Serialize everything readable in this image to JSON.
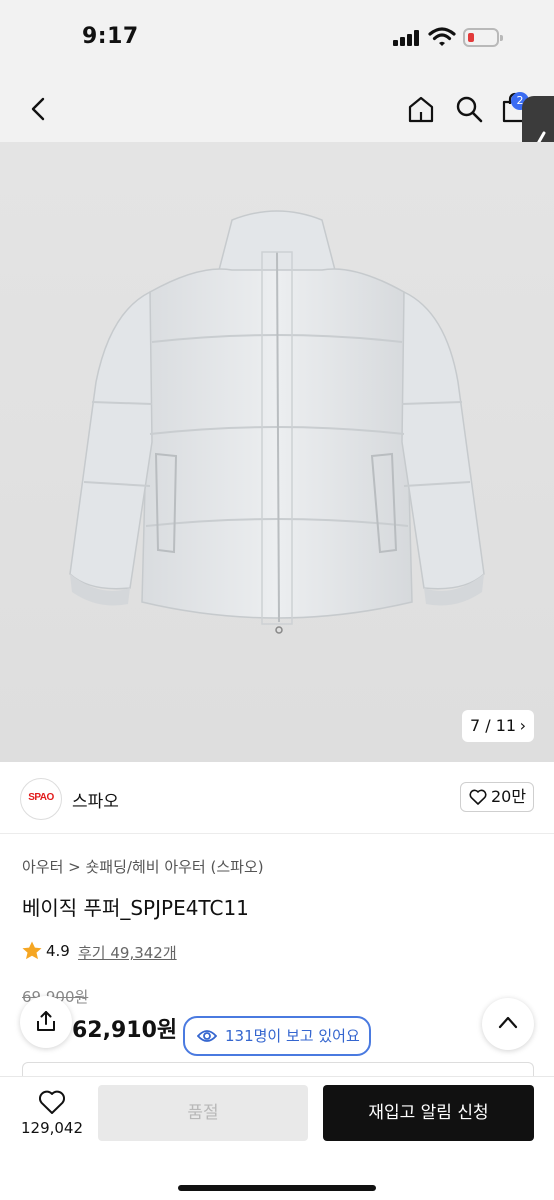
{
  "status_bar": {
    "time": "9:17",
    "icons": [
      "signal-icon",
      "wifi-icon",
      "battery-low-icon"
    ],
    "battery_color": "#e23b3b"
  },
  "nav": {
    "icons": [
      "back-chevron-icon",
      "home-icon",
      "search-icon",
      "shopping-bag-icon"
    ],
    "cart_badge": "2",
    "badge_color": "#3b6cf2"
  },
  "gallery": {
    "current": "7",
    "total": "11",
    "counter_text": "7 / 11",
    "next_icon": "chevron-right-icon"
  },
  "brand": {
    "logo_text": "SPAO",
    "name": "스파오",
    "logo_color": "#e21b1b",
    "like_count": "20만"
  },
  "product": {
    "breadcrumb": "아우터 > 숏패딩/헤비 아우터 (스파오)",
    "title": "베이직 푸퍼_SPJPE4TC11",
    "rating": "4.9",
    "review_text": "후기 49,342개",
    "original_price": "69,900원",
    "sale_price": "62,910원",
    "viewers_text": "131명이 보고 있어요",
    "accent_color": "#3566cf"
  },
  "bottom_bar": {
    "wish_count": "129,042",
    "soldout_label": "품절",
    "restock_label": "재입고 알림 신청"
  }
}
